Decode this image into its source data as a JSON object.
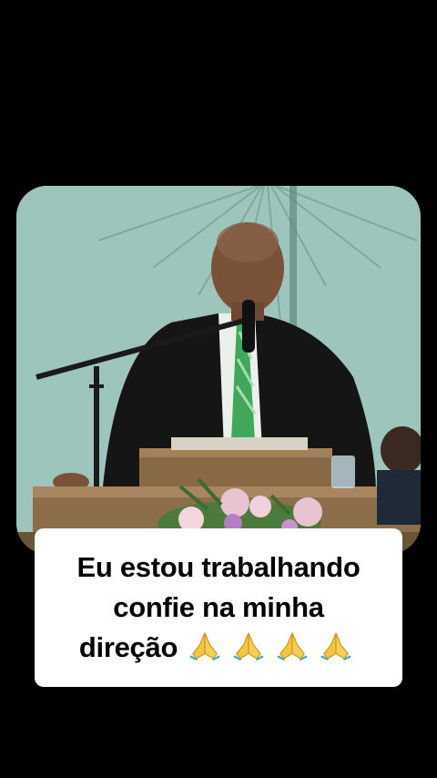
{
  "video": {
    "scene": "sermon-video",
    "colors": {
      "background": "#000000",
      "wall": "#9cc4ba",
      "suit": "#151515",
      "shirt": "#e9f1ea",
      "tie": "#3fa85a",
      "pulpit": "#8a6a45",
      "flowers": "#e8c4d2"
    }
  },
  "caption": {
    "line1": "Eu estou trabalhando",
    "line2": "confie na minha",
    "line3": "direção",
    "emojis": [
      "folded-hands-icon",
      "folded-hands-icon",
      "folded-hands-icon",
      "folded-hands-icon"
    ]
  }
}
